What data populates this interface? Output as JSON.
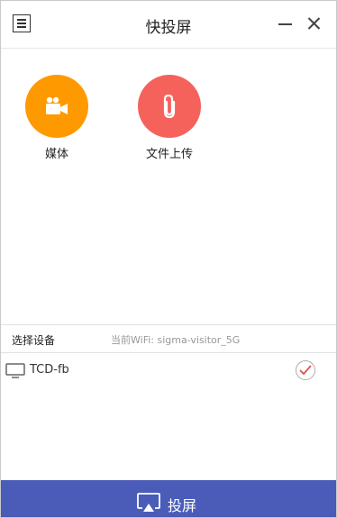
{
  "window": {
    "title": "快投屏"
  },
  "icons": {
    "menu": "menu-icon",
    "minimize": "minimize-icon",
    "close": "close-icon",
    "media": "video-camera-icon",
    "upload": "paperclip-icon",
    "tv": "monitor-icon",
    "check": "check-icon",
    "cast": "screen-cast-icon"
  },
  "features": [
    {
      "label": "媒体",
      "color": "#ff9900"
    },
    {
      "label": "文件上传",
      "color": "#f5625c"
    }
  ],
  "devices_section": {
    "label": "选择设备",
    "wifi_text": "当前WiFi: sigma-visitor_5G",
    "devices": [
      {
        "name": "TCD-fb",
        "selected": true
      }
    ]
  },
  "cast_button": {
    "label": "投屏",
    "color": "#4a5cb8"
  }
}
